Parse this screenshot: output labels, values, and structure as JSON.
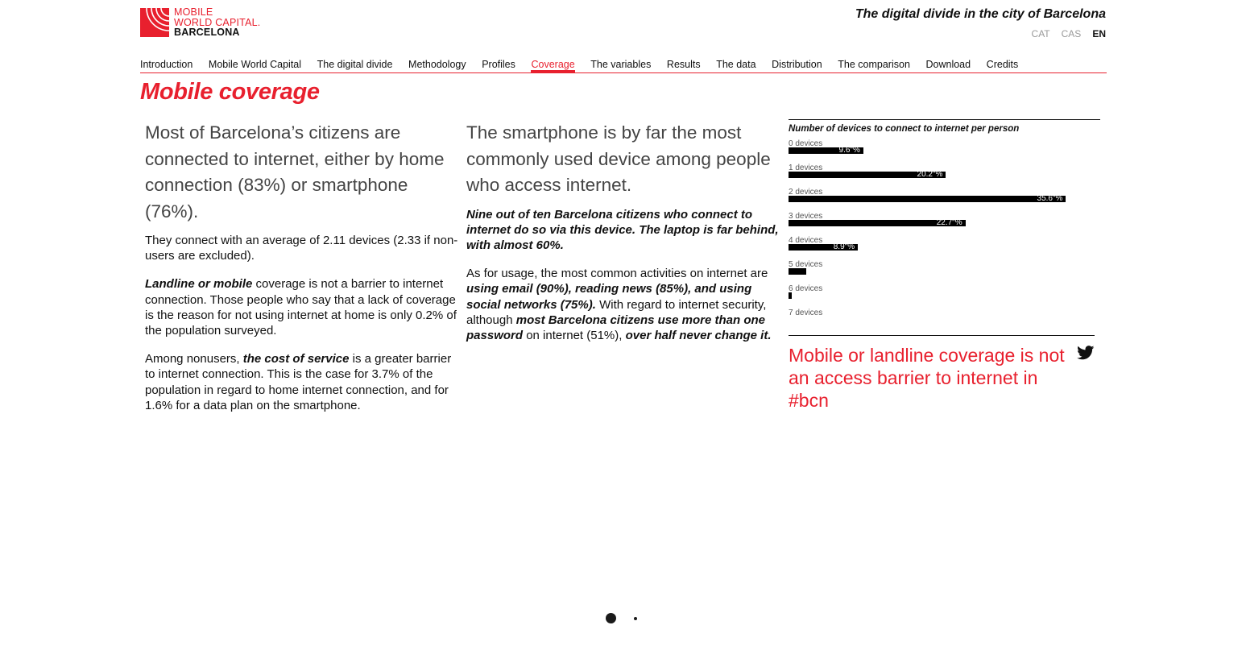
{
  "logo": {
    "line1": "MOBILE",
    "line2": "WORLD CAPITAL.",
    "line3": "BARCELONA"
  },
  "site_title": "The digital divide in the city of Barcelona",
  "languages": [
    "CAT",
    "CAS",
    "EN"
  ],
  "active_language": "EN",
  "nav": {
    "items": [
      "Introduction",
      "Mobile World Capital",
      "The digital divide",
      "Methodology",
      "Profiles",
      "Coverage",
      "The variables",
      "Results",
      "The data",
      "Distribution",
      "The comparison",
      "Download",
      "Credits"
    ],
    "active": "Coverage"
  },
  "page_title": "Mobile coverage",
  "col1": {
    "lead": "Most of Barcelona’s citizens are connected to internet, either by home connection (83%) or smartphone (76%).",
    "p1": "They connect with an average of 2.11 devices (2.33 if non-users are excluded).",
    "p2_em": "Landline or mobile",
    "p2_rest": " coverage is not a barrier to internet connection. Those people who say that a lack of coverage is the reason for not using internet at home is only 0.2% of the population surveyed.",
    "p3_a": "Among nonusers, ",
    "p3_em": "the cost of service",
    "p3_b": " is a greater barrier to internet connection. This is the case for 3.7% of the population in regard to home internet connection, and for 1.6% for a data plan on the smartphone."
  },
  "col2": {
    "lead": "The smartphone is by far the most commonly used device among people who access internet.",
    "strong": "Nine out of ten Barcelona citizens who connect to internet do so via this device. The laptop is far behind, with almost 60%.",
    "p_a": "As for usage, the most common activities on internet are ",
    "p_em1": "using email (90%), reading news (85%), and using social networks (75%).",
    "p_b": " With regard to internet security, although ",
    "p_em2": "most Barcelona citizens use more than one password",
    "p_c": " on internet (51%), ",
    "p_em3": "over half never change it."
  },
  "chart_data": {
    "type": "bar",
    "orientation": "horizontal",
    "title": "Number of devices to connect to internet per person",
    "categories": [
      "0 devices",
      "1 devices",
      "2 devices",
      "3 devices",
      "4 devices",
      "5 devices",
      "6 devices",
      "7 devices"
    ],
    "values": [
      9.6,
      20.2,
      35.6,
      22.7,
      8.9,
      2.3,
      0.4,
      0.0
    ],
    "value_labels": [
      "9.6\"%",
      "20.2\"%",
      "35.6\"%",
      "22.7\"%",
      "8.9\"%",
      "",
      "",
      ""
    ],
    "xlim": [
      0,
      40
    ],
    "grid": false,
    "legend": "none",
    "bar_color": "#000000"
  },
  "tweet": {
    "text": "Mobile or landline coverage is not an access barrier to internet in #bcn",
    "icon": "twitter-icon"
  },
  "pager": {
    "count": 2,
    "active": 1
  },
  "colors": {
    "accent": "#e8202e",
    "text": "#111111",
    "muted": "#9a9a9a"
  }
}
